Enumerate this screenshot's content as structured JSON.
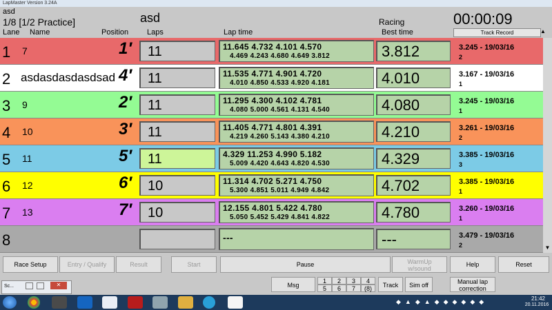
{
  "app": {
    "window_title": "LapMaster Version 3.24A"
  },
  "header": {
    "event": "asd",
    "heat": "1/8 [1/2 Practice]",
    "race_name": "asd",
    "status": "Racing",
    "clock": "00:00:09"
  },
  "columns": {
    "lane": "Lane",
    "name": "Name",
    "position": "Position",
    "laps": "Laps",
    "lap_time": "Lap time",
    "best_time": "Best time",
    "track_record": "Track Record"
  },
  "rows": [
    {
      "lane": "1",
      "name": "7",
      "position": "1′",
      "laps": "11",
      "lap_line1": "11.645   4.732   4.101   4.570",
      "lap_line2": "4.469   4.243   4.680   4.649   3.812",
      "best": "3.812",
      "record": "3.245 - 19/03/16",
      "record_num": "2",
      "color": "#e8696a"
    },
    {
      "lane": "2",
      "name": "asdasdasdasdsad",
      "position": "4′",
      "laps": "11",
      "lap_line1": "11.535   4.771   4.901   4.720",
      "lap_line2": "4.010   4.850   4.533   4.920   4.181",
      "best": "4.010",
      "record": "3.167 - 19/03/16",
      "record_num": "1",
      "color": "#ffffff"
    },
    {
      "lane": "3",
      "name": "9",
      "position": "2′",
      "laps": "11",
      "lap_line1": "11.295   4.300   4.102   4.781",
      "lap_line2": "4.080   5.000   4.561   4.131   4.540",
      "best": "4.080",
      "record": "3.245 - 19/03/16",
      "record_num": "1",
      "color": "#94fb94"
    },
    {
      "lane": "4",
      "name": "10",
      "position": "3′",
      "laps": "11",
      "lap_line1": "11.405   4.771   4.801   4.391",
      "lap_line2": "4.219   4.260   5.143   4.380   4.210",
      "best": "4.210",
      "record": "3.261 - 19/03/16",
      "record_num": "2",
      "color": "#f9935a"
    },
    {
      "lane": "5",
      "name": "11",
      "position": "5′",
      "laps": "11",
      "lap_line1": "4.329   11.253   4.990   5.182",
      "lap_line2": "5.009   4.420   4.643   4.820   4.530",
      "best": "4.329",
      "record": "3.385 - 19/03/16",
      "record_num": "3",
      "color": "#7ccbe6"
    },
    {
      "lane": "6",
      "name": "12",
      "position": "6′",
      "laps": "10",
      "lap_line1": "11.314   4.702   5.271   4.750",
      "lap_line2": "5.300   4.851   5.011   4.949   4.842",
      "best": "4.702",
      "record": "3.385 - 19/03/16",
      "record_num": "1",
      "color": "#ffff00"
    },
    {
      "lane": "7",
      "name": "13",
      "position": "7′",
      "laps": "10",
      "lap_line1": "12.155   4.801   5.422   4.780",
      "lap_line2": "5.050   5.452   5.429   4.841   4.822",
      "best": "4.780",
      "record": "3.260 - 19/03/16",
      "record_num": "1",
      "color": "#da7ef0"
    },
    {
      "lane": "8",
      "name": "",
      "position": "",
      "laps": "",
      "lap_line1": "---",
      "lap_line2": "",
      "best": "---",
      "record": "3.479 - 19/03/16",
      "record_num": "2",
      "color": "#a9a9a9"
    }
  ],
  "buttons": {
    "race_setup": "Race Setup",
    "entry_qualify": "Entry / Qualify",
    "result": "Result",
    "start": "Start",
    "pause": "Pause",
    "warmup_line1": "WarmUp",
    "warmup_line2": "w/sound",
    "help": "Help",
    "reset": "Reset",
    "msg": "Msg",
    "track": "Track",
    "sim_off": "Sim off",
    "manual_line1": "Manual lap",
    "manual_line2": "correction",
    "grid": [
      "1",
      "2",
      "3",
      "4",
      "5",
      "6",
      "7",
      "(8)"
    ]
  },
  "taskbar": {
    "time": "21:42",
    "date": "20.11.2016",
    "mini_window": "Sc..."
  }
}
